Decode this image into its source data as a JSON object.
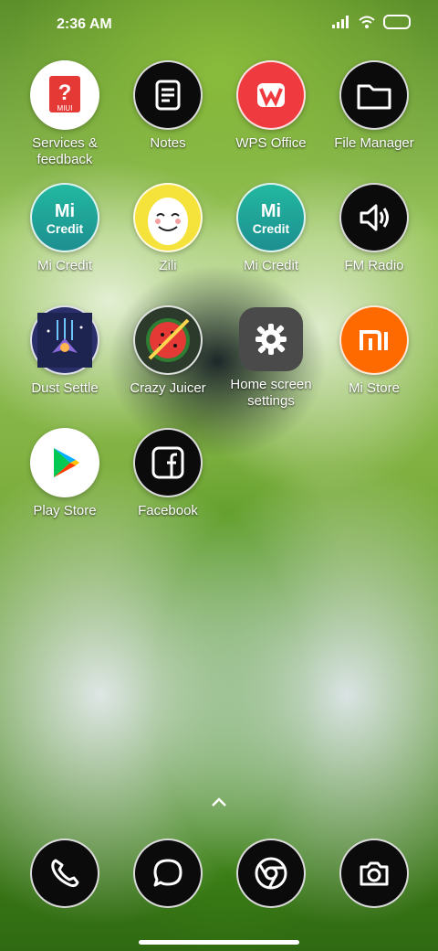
{
  "status_bar": {
    "time": "2:36 AM"
  },
  "apps": [
    {
      "name": "services-feedback",
      "label": "Services &\nfeedback",
      "icon": "miui-question-icon",
      "badge": "MIUI"
    },
    {
      "name": "notes",
      "label": "Notes",
      "icon": "notes-icon"
    },
    {
      "name": "wps-office",
      "label": "WPS Office",
      "icon": "wps-icon"
    },
    {
      "name": "file-manager",
      "label": "File Manager",
      "icon": "folder-icon"
    },
    {
      "name": "mi-credit-1",
      "label": "Mi Credit",
      "icon": "mi-credit-icon",
      "badge": "Credit"
    },
    {
      "name": "zili",
      "label": "Zili",
      "icon": "zili-face-icon"
    },
    {
      "name": "mi-credit-2",
      "label": "Mi Credit",
      "icon": "mi-credit-icon",
      "badge": "Credit"
    },
    {
      "name": "fm-radio",
      "label": "FM Radio",
      "icon": "speaker-icon"
    },
    {
      "name": "dust-settle",
      "label": "Dust Settle",
      "icon": "spaceship-icon"
    },
    {
      "name": "crazy-juicer",
      "label": "Crazy Juicer",
      "icon": "watermelon-icon"
    },
    {
      "name": "home-screen-settings",
      "label": "Home screen\nsettings",
      "icon": "gear-icon"
    },
    {
      "name": "mi-store",
      "label": "Mi Store",
      "icon": "mi-logo-icon"
    },
    {
      "name": "play-store",
      "label": "Play Store",
      "icon": "play-store-icon"
    },
    {
      "name": "facebook",
      "label": "Facebook",
      "icon": "facebook-icon"
    }
  ],
  "dock": [
    {
      "name": "phone",
      "icon": "phone-icon"
    },
    {
      "name": "messages",
      "icon": "message-icon"
    },
    {
      "name": "browser",
      "icon": "chrome-icon"
    },
    {
      "name": "camera",
      "icon": "camera-icon"
    }
  ]
}
